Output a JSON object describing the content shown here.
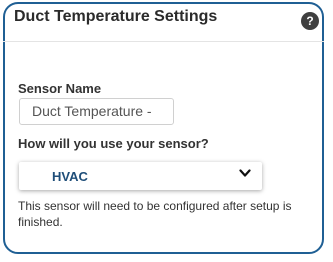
{
  "panel": {
    "title": "Duct Temperature Settings",
    "help_symbol": "?"
  },
  "sensor_name": {
    "label": "Sensor Name",
    "value": "Duct Temperature -"
  },
  "usage": {
    "question": "How will you use your sensor?",
    "selected": "HVAC"
  },
  "note": "This sensor will need to be configured after setup is finished.",
  "colors": {
    "border": "#1f5f94",
    "select_text": "#1f4e79",
    "help_icon_bg": "#3f3f3f"
  },
  "icons": {
    "help": "question-circle-icon",
    "dropdown": "chevron-down-icon"
  }
}
